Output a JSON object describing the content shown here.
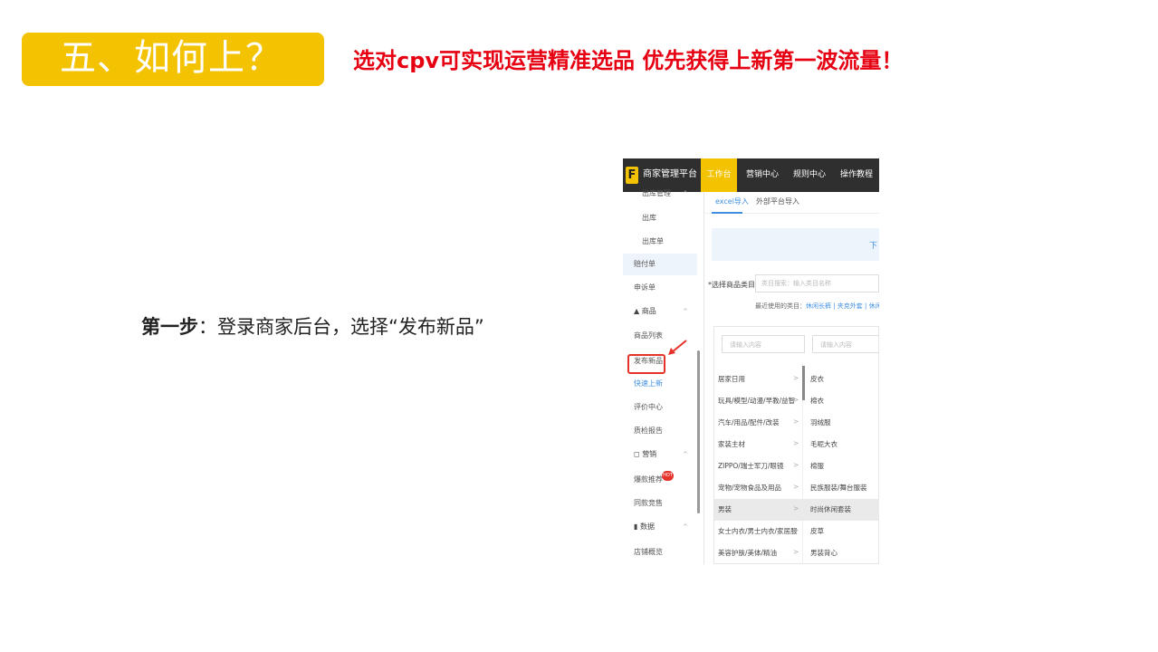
{
  "slide": {
    "title": "五、如何上？",
    "headline": "选对cpv可实现运营精准选品 优先获得上新第一波流量！",
    "step_label": "第一步",
    "step_text": "：登录商家后台，选择“发布新品”",
    "accent_color": "#f3c200",
    "headline_color": "#e60012"
  },
  "screenshot": {
    "logo": "F",
    "brand": "商家管理平台",
    "nav": [
      "工作台",
      "营销中心",
      "规则中心",
      "操作教程"
    ],
    "sidebar": {
      "items": [
        {
          "label": "出库管理"
        },
        {
          "label": "出库"
        },
        {
          "label": "出库单"
        },
        {
          "label": "赔付单"
        },
        {
          "label": "申诉单"
        },
        {
          "label": "商品"
        },
        {
          "label": "商品列表"
        },
        {
          "label": "发布新品"
        },
        {
          "label": "快速上新"
        },
        {
          "label": "评价中心"
        },
        {
          "label": "质检报告"
        },
        {
          "label": "营销"
        },
        {
          "label": "爆款推荐"
        },
        {
          "label": "同款竞售"
        },
        {
          "label": "数据"
        },
        {
          "label": "店铺概览"
        }
      ],
      "hot_badge": "HOT"
    },
    "tabs": [
      "excel导入",
      "外部平台导入"
    ],
    "banner_text": "下",
    "category_label": "*选择商品类目",
    "category_placeholder": "类目搜索：输入类目名称",
    "recent_prefix": "最近使用的类目：",
    "recent_links": "休闲长裤 | 夹克外套 | 休闲",
    "picker": {
      "left_placeholder": "请输入内容",
      "right_placeholder": "请输入内容",
      "rows": [
        {
          "left": "居家日用",
          "right": "皮衣"
        },
        {
          "left": "玩具/模型/动漫/早教/益智",
          "right": "棉衣"
        },
        {
          "left": "汽车/用品/配件/改装",
          "right": "羽绒服"
        },
        {
          "left": "家装主材",
          "right": "毛呢大衣"
        },
        {
          "left": "ZIPPO/瑞士军刀/眼镜",
          "right": "棉服"
        },
        {
          "left": "宠物/宠物食品及用品",
          "right": "民族服装/舞台服装"
        },
        {
          "left": "男装",
          "right": "时尚休闲套装"
        },
        {
          "left": "女士内衣/男士内衣/家居服",
          "right": "皮草"
        },
        {
          "left": "美容护肤/美体/精油",
          "right": "男装背心"
        }
      ],
      "selected_index": 6
    }
  }
}
